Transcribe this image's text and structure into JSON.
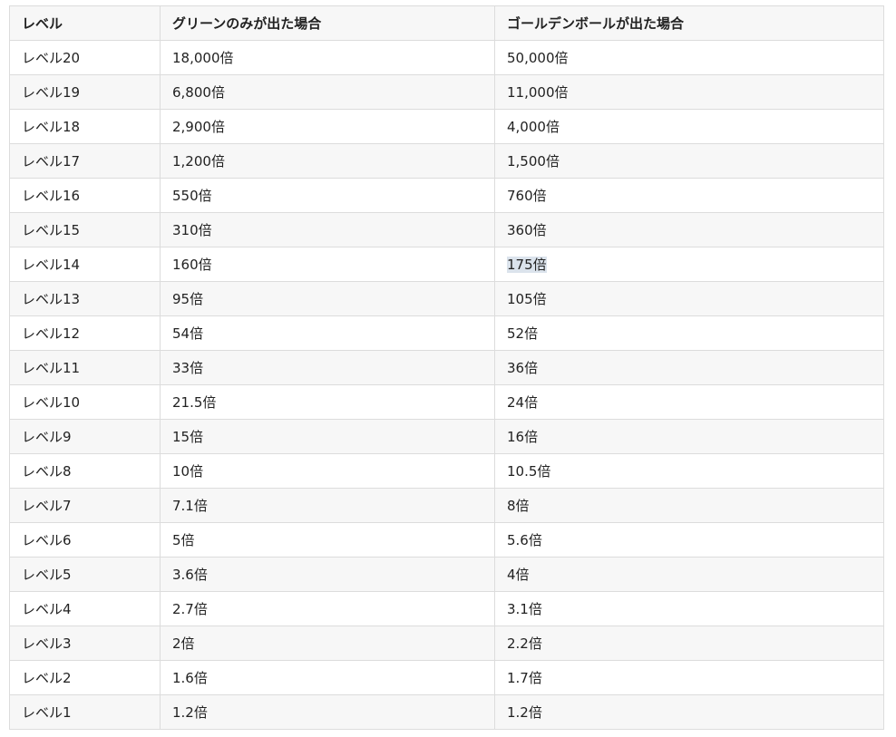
{
  "table": {
    "headers": [
      "レベル",
      "グリーンのみが出た場合",
      "ゴールデンボールが出た場合"
    ],
    "rows": [
      [
        "レベル20",
        "18,000倍",
        "50,000倍"
      ],
      [
        "レベル19",
        "6,800倍",
        "11,000倍"
      ],
      [
        "レベル18",
        "2,900倍",
        "4,000倍"
      ],
      [
        "レベル17",
        "1,200倍",
        "1,500倍"
      ],
      [
        "レベル16",
        "550倍",
        "760倍"
      ],
      [
        "レベル15",
        "310倍",
        "360倍"
      ],
      [
        "レベル14",
        "160倍",
        "175倍"
      ],
      [
        "レベル13",
        "95倍",
        "105倍"
      ],
      [
        "レベル12",
        "54倍",
        "52倍"
      ],
      [
        "レベル11",
        "33倍",
        "36倍"
      ],
      [
        "レベル10",
        "21.5倍",
        "24倍"
      ],
      [
        "レベル9",
        "15倍",
        "16倍"
      ],
      [
        "レベル8",
        "10倍",
        "10.5倍"
      ],
      [
        "レベル7",
        "7.1倍",
        "8倍"
      ],
      [
        "レベル6",
        "5倍",
        "5.6倍"
      ],
      [
        "レベル5",
        "3.6倍",
        "4倍"
      ],
      [
        "レベル4",
        "2.7倍",
        "3.1倍"
      ],
      [
        "レベル3",
        "2倍",
        "2.2倍"
      ],
      [
        "レベル2",
        "1.6倍",
        "1.7倍"
      ],
      [
        "レベル1",
        "1.2倍",
        "1.2倍"
      ]
    ]
  }
}
